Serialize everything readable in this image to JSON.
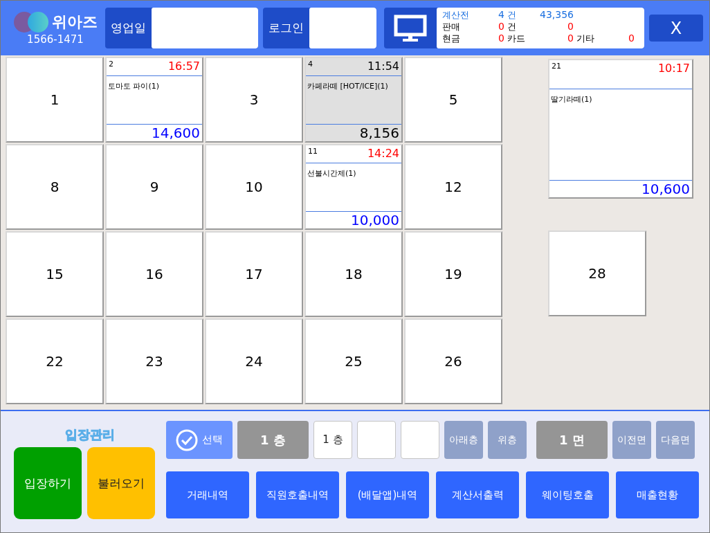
{
  "header": {
    "brand": "위아즈",
    "phone": "1566-1471",
    "fields": [
      {
        "label": "영업일"
      },
      {
        "label": "로그인"
      }
    ],
    "summary": [
      {
        "highlighted": true,
        "cells": [
          {
            "text": "계산전",
            "kind": "label"
          },
          {
            "text": "4",
            "kind": "value"
          },
          {
            "text": "건",
            "kind": "label"
          },
          {
            "text": "43,356",
            "kind": "value"
          }
        ]
      },
      {
        "highlighted": false,
        "cells": [
          {
            "text": "판매",
            "kind": "label"
          },
          {
            "text": "0",
            "kind": "value"
          },
          {
            "text": "건",
            "kind": "label"
          },
          {
            "text": "0",
            "kind": "value"
          }
        ]
      },
      {
        "highlighted": false,
        "cells": [
          {
            "text": "현금",
            "kind": "label"
          },
          {
            "text": "0",
            "kind": "value"
          },
          {
            "text": "카드",
            "kind": "label"
          },
          {
            "text": "0",
            "kind": "value"
          },
          {
            "text": "기타",
            "kind": "label"
          },
          {
            "text": "0",
            "kind": "value"
          }
        ]
      }
    ],
    "close": "X"
  },
  "tables": [
    {
      "number": "1",
      "kind": "empty"
    },
    {
      "number": "2",
      "kind": "occupied",
      "selected": false,
      "time": "16:57",
      "item": "토마토 파이(1)",
      "amount": "14,600"
    },
    {
      "number": "3",
      "kind": "empty"
    },
    {
      "number": "4",
      "kind": "occupied",
      "selected": true,
      "time": "11:54",
      "item": "카페라떼 [HOT/ICE](1)",
      "amount": "8,156"
    },
    {
      "number": "5",
      "kind": "empty"
    },
    {
      "number": "8",
      "kind": "empty"
    },
    {
      "number": "9",
      "kind": "empty"
    },
    {
      "number": "10",
      "kind": "empty"
    },
    {
      "number": "11",
      "kind": "occupied",
      "selected": false,
      "time": "14:24",
      "item": "선불시간제(1)",
      "amount": "10,000"
    },
    {
      "number": "12",
      "kind": "empty"
    },
    {
      "number": "15",
      "kind": "empty"
    },
    {
      "number": "16",
      "kind": "empty"
    },
    {
      "number": "17",
      "kind": "empty"
    },
    {
      "number": "18",
      "kind": "empty"
    },
    {
      "number": "19",
      "kind": "empty"
    },
    {
      "number": "22",
      "kind": "empty"
    },
    {
      "number": "23",
      "kind": "empty"
    },
    {
      "number": "24",
      "kind": "empty"
    },
    {
      "number": "25",
      "kind": "empty"
    },
    {
      "number": "26",
      "kind": "empty"
    }
  ],
  "side_tables": [
    {
      "number": "21",
      "kind": "occupied",
      "selected": false,
      "time": "10:17",
      "item": "딸기라떼(1)",
      "amount": "10,600"
    },
    {
      "number": "28",
      "kind": "empty"
    }
  ],
  "entry": {
    "title": "입장관리",
    "buttons": [
      {
        "label": "입장하기",
        "color": "#00a000"
      },
      {
        "label": "불러오기",
        "color": "#ffc000"
      }
    ]
  },
  "controls": [
    {
      "kind": "select",
      "label": "선택"
    },
    {
      "kind": "display",
      "label": "1 층"
    },
    {
      "kind": "slot",
      "label": "1 층"
    },
    {
      "kind": "slot"
    },
    {
      "kind": "slot"
    },
    {
      "kind": "nav",
      "label": "아래층"
    },
    {
      "kind": "nav",
      "label": "위층"
    },
    {
      "kind": "display",
      "label": "1 면"
    },
    {
      "kind": "nav",
      "label": "이전면"
    },
    {
      "kind": "nav",
      "label": "다음면"
    }
  ],
  "actions": [
    "거래내역",
    "직원호출내역",
    "(배달앱)내역",
    "계산서출력",
    "웨이팅호출",
    "매출현황"
  ]
}
